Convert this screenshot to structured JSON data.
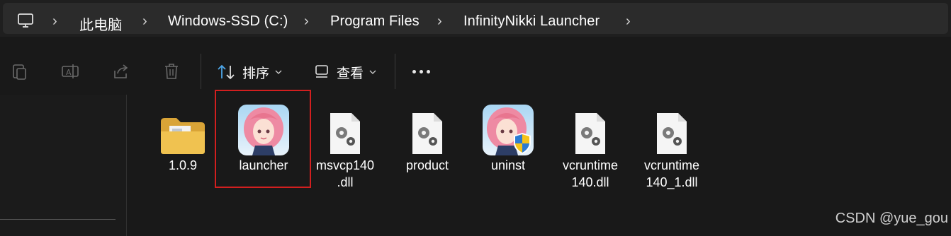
{
  "address_bar": {
    "crumbs": [
      "此电脑",
      "Windows-SSD (C:)",
      "Program Files",
      "InfinityNikki Launcher"
    ]
  },
  "toolbar": {
    "sort_label": "排序",
    "view_label": "查看"
  },
  "files": [
    {
      "name": "1.0.9",
      "type": "folder"
    },
    {
      "name": "launcher",
      "type": "app",
      "selected": true
    },
    {
      "name": "msvcp140\n.dll",
      "type": "dll"
    },
    {
      "name": "product",
      "type": "config"
    },
    {
      "name": "uninst",
      "type": "app-shield"
    },
    {
      "name": "vcruntime\n140.dll",
      "type": "dll"
    },
    {
      "name": "vcruntime\n140_1.dll",
      "type": "dll"
    }
  ],
  "watermark": "CSDN @yue_gou",
  "colors": {
    "background": "#191919",
    "highlight": "#d21f1f",
    "folder": "#e8b847"
  }
}
